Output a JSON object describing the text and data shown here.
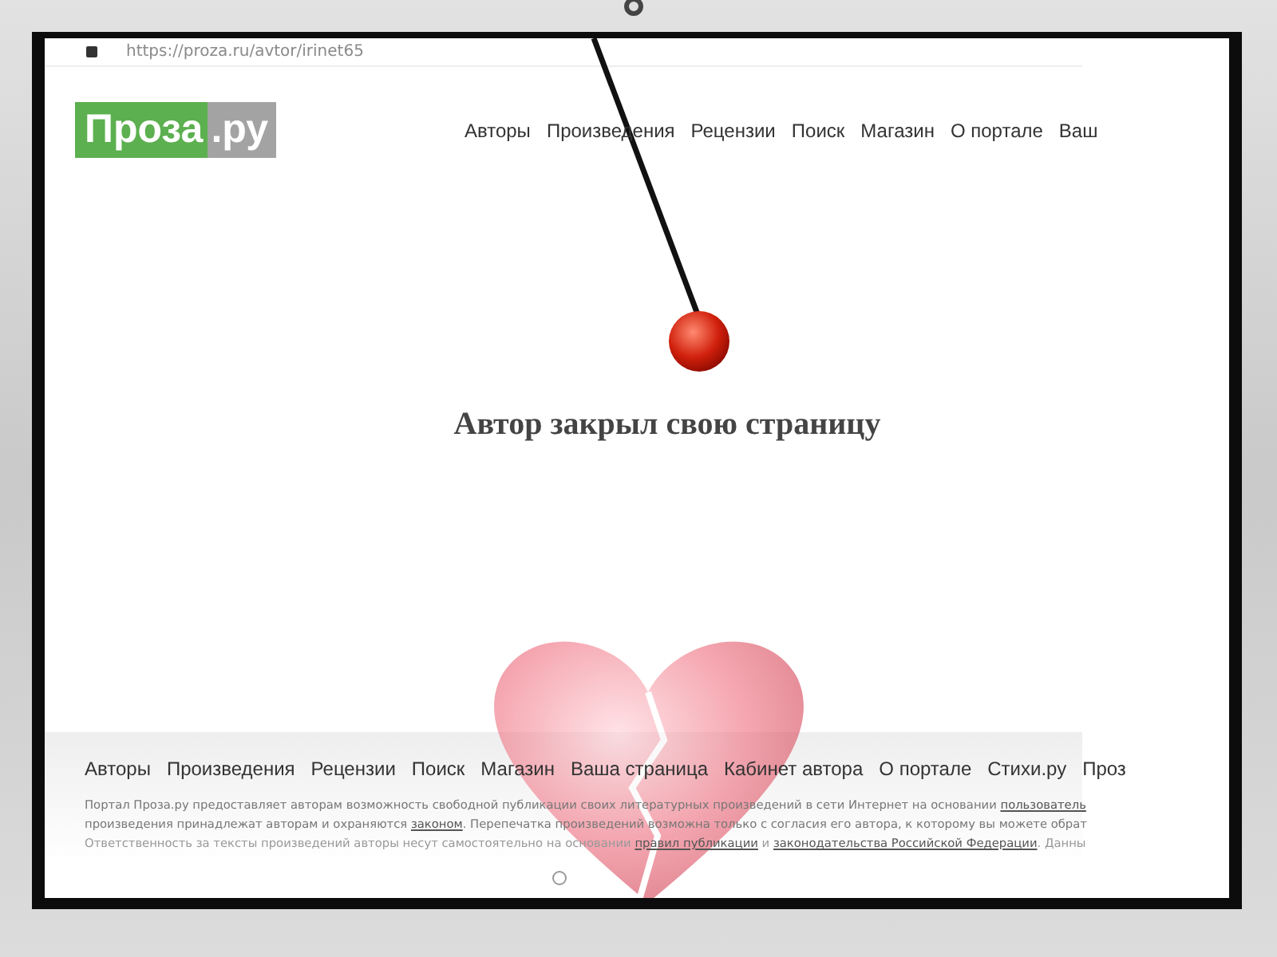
{
  "address_bar": {
    "url": "https://proza.ru/avtor/irinet65"
  },
  "logo": {
    "main": "Проза",
    "suffix": ".ру"
  },
  "nav": [
    "Авторы",
    "Произведения",
    "Рецензии",
    "Поиск",
    "Магазин",
    "О портале",
    "Ваш"
  ],
  "message": "Автор закрыл свою страницу",
  "footer": {
    "nav": [
      "Авторы",
      "Произведения",
      "Рецензии",
      "Поиск",
      "Магазин",
      "Ваша страница",
      "Кабинет автора",
      "О портале",
      "Стихи.ру",
      "Проз"
    ],
    "lines": [
      [
        {
          "text": "Портал Проза.ру предоставляет авторам возможность свободной публикации своих литературных произведений в сети Интернет на основании ",
          "link": false
        },
        {
          "text": "пользователь",
          "link": true
        }
      ],
      [
        {
          "text": "произведения принадлежат авторам и охраняются ",
          "link": false
        },
        {
          "text": "законом",
          "link": true
        },
        {
          "text": ". Перепечатка произведений возможна только с согласия его автора, к которому вы можете обрат",
          "link": false
        }
      ],
      [
        {
          "text": "Ответственность за тексты произведений авторы несут самостоятельно на основании ",
          "link": false
        },
        {
          "text": "правил публикации",
          "link": true
        },
        {
          "text": " и ",
          "link": false
        },
        {
          "text": "законодательства Российской Федерации",
          "link": true
        },
        {
          "text": ". Данны",
          "link": false
        }
      ]
    ]
  }
}
